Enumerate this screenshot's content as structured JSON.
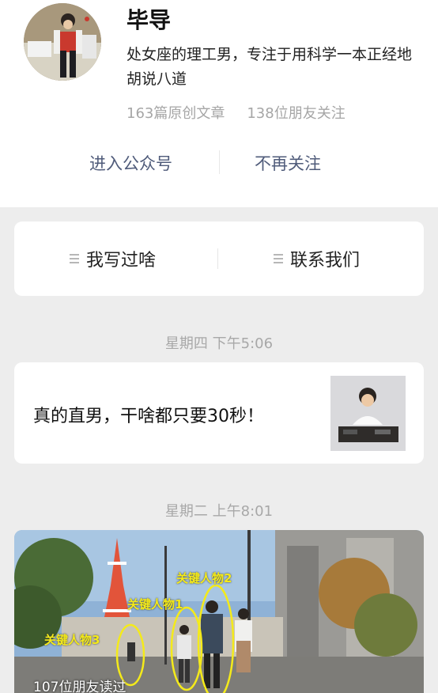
{
  "profile": {
    "name": "毕导",
    "bio": "处女座的理工男，专注于用科学一本正经地胡说八道",
    "articles": "163篇原创文章",
    "followers": "138位朋友关注",
    "enter_label": "进入公众号",
    "unfollow_label": "不再关注"
  },
  "menu": [
    {
      "label": "我写过啥"
    },
    {
      "label": "联系我们"
    }
  ],
  "feed": {
    "time1": "星期四 下午5:06",
    "card_title": "真的直男，干啥都只要30秒！",
    "time2": "星期二 上午8:01",
    "video": {
      "tag1": "关键人物3",
      "tag2": "关键人物1",
      "tag3": "关键人物2",
      "reads": "107位朋友读过"
    }
  },
  "colors": {
    "action_link": "#4f5b7a",
    "background": "#ededed",
    "tag_yellow": "#f4ea1a"
  }
}
